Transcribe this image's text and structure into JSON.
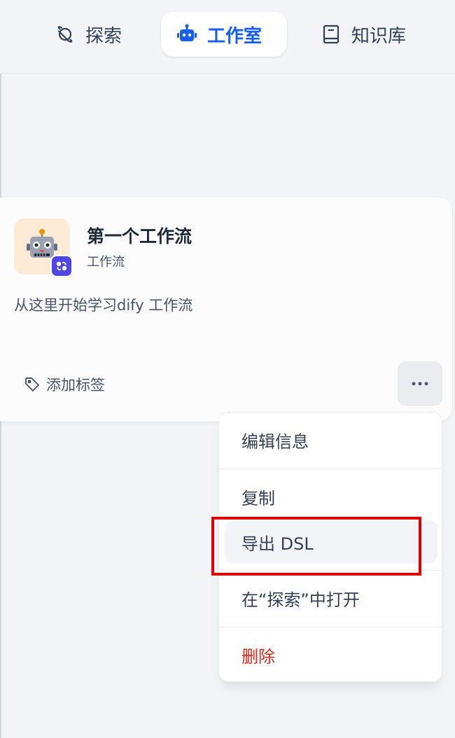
{
  "nav": {
    "explore_label": "探索",
    "studio_label": "工作室",
    "knowledge_label": "知识库",
    "active": "studio",
    "active_color": "#155eef"
  },
  "app_card": {
    "name": "第一个工作流",
    "type": "工作流",
    "description": "从这里开始学习dify 工作流",
    "add_tag_label": "添加标签",
    "avatar_icon": "robot-emoji-icon",
    "avatar_bg": "#ffead5",
    "badge_icon": "workflow-icon",
    "badge_color": "#4f46e5"
  },
  "menu": {
    "items": [
      {
        "label": "编辑信息"
      },
      {
        "label": "复制"
      },
      {
        "label": "导出 DSL"
      },
      {
        "label": "在“探索”中打开"
      },
      {
        "label": "删除"
      }
    ],
    "danger_color": "#d92d20"
  },
  "annotation": {
    "highlight_color": "#e00000"
  }
}
